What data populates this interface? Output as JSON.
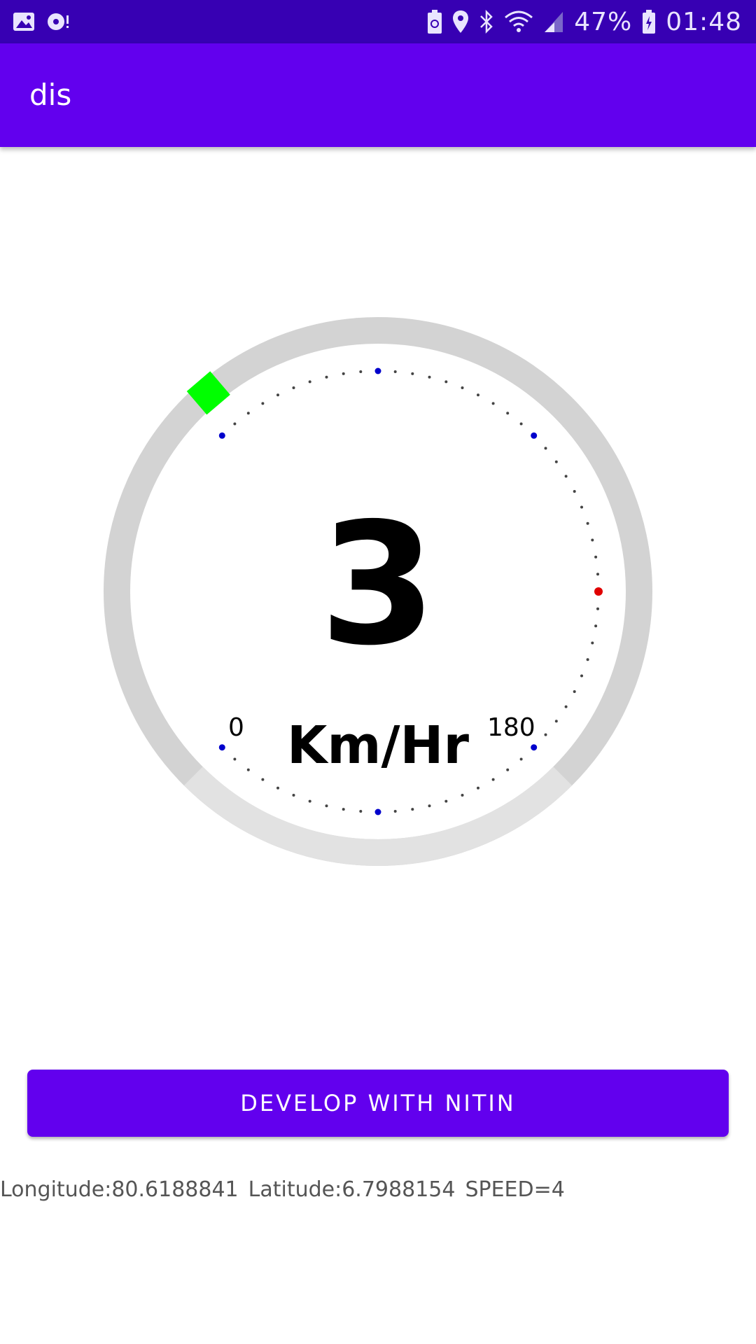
{
  "status_bar": {
    "battery_percent": "47%",
    "time": "01:48",
    "left_icons": [
      "image-icon",
      "media-notification-icon"
    ],
    "right_icons": [
      "battery-saver-icon",
      "location-icon",
      "bluetooth-icon",
      "wifi-icon",
      "signal-icon",
      "battery-icon"
    ]
  },
  "app_bar": {
    "title": "dis"
  },
  "speedometer": {
    "speed": "3",
    "unit": "Km/Hr",
    "scale_min": "0",
    "scale_max": "180",
    "speed_level": 3,
    "colors": {
      "track": "#d3d3d3",
      "indicator": "#00ff00",
      "major_tick": "#0000cc",
      "top_tick": "#e00000",
      "minor_tick": "#444444"
    }
  },
  "button": {
    "label": "DEVELOP WITH NITIN"
  },
  "location": {
    "longitude": "Longitude:80.6188841",
    "latitude": "Latitude:6.7988154",
    "speed": "SPEED=4"
  },
  "theme": {
    "primary": "#6200ee",
    "primary_dark": "#3700b3"
  }
}
